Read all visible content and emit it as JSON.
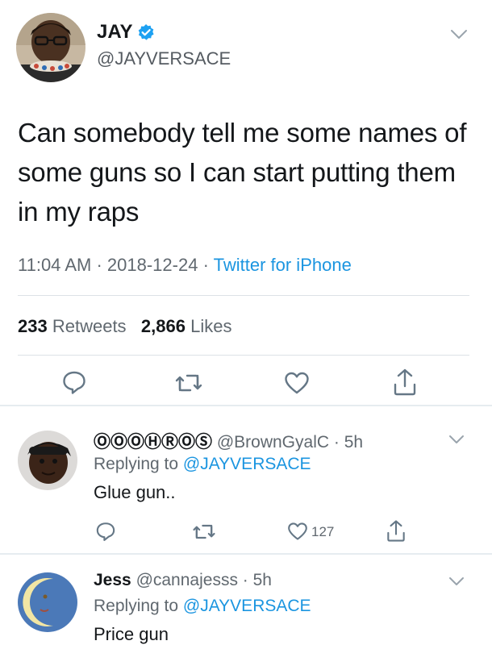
{
  "main_tweet": {
    "display_name": "JAY",
    "handle": "@JAYVERSACE",
    "text": "Can somebody tell me some names of some guns so I can start putting them in my raps",
    "time": "11:04 AM",
    "date": "2018-12-24",
    "source": "Twitter for iPhone",
    "separator": "·",
    "retweet_count": "233",
    "retweet_label": "Retweets",
    "like_count": "2,866",
    "like_label": "Likes"
  },
  "replies": [
    {
      "display_name": "ⓄⓄⓄⒽⓇⓄⓈ",
      "handle": "@BrownGyalC",
      "age": "· 5h",
      "replying_prefix": "Replying to",
      "replying_to": "@JAYVERSACE",
      "text": "Glue gun..",
      "like_count": "127"
    },
    {
      "display_name": "Jess",
      "handle": "@cannajesss",
      "age": "· 5h",
      "replying_prefix": "Replying to",
      "replying_to": "@JAYVERSACE",
      "text": "Price gun"
    }
  ],
  "icons": {
    "reply": "reply-icon",
    "retweet": "retweet-icon",
    "like": "heart-icon",
    "share": "share-icon",
    "menu": "chevron-down-icon",
    "verified": "verified-badge-icon"
  },
  "colors": {
    "link_blue": "#1b95e0",
    "verified_blue": "#1da1f2",
    "muted_gray": "#657786",
    "text_dark": "#14171a"
  }
}
